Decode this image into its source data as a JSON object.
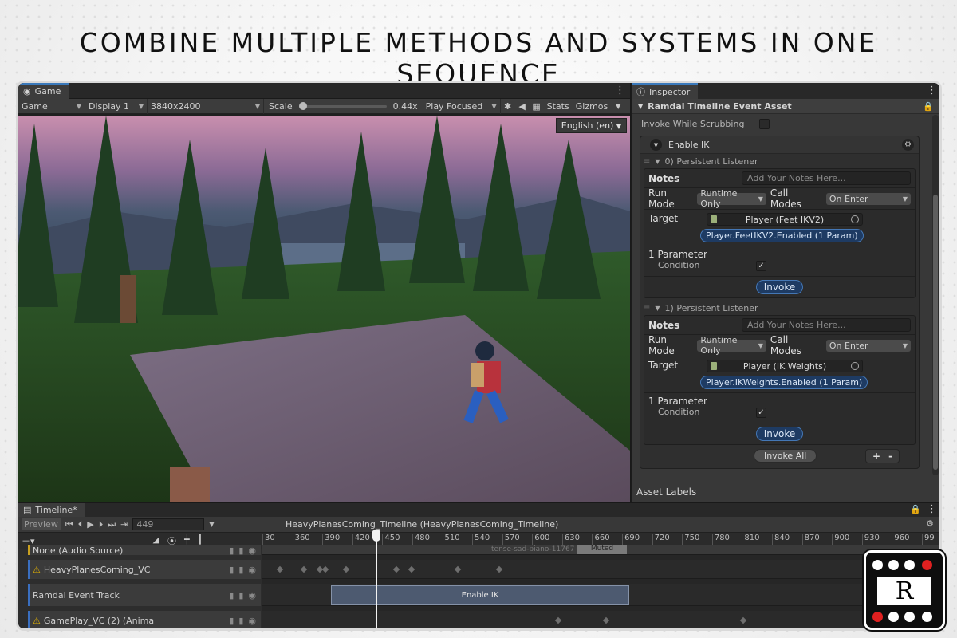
{
  "headline": "COMBINE MULTIPLE METHODS AND SYSTEMS IN ONE SEQUENCE",
  "game": {
    "tab_label": "Game",
    "mode": "Game",
    "display": "Display 1",
    "resolution": "3840x2400",
    "scale_label": "Scale",
    "scale_value": "0.44x",
    "play_focused": "Play Focused",
    "stats": "Stats",
    "gizmos": "Gizmos",
    "language": "English (en)"
  },
  "inspector": {
    "tab_label": "Inspector",
    "component_title": "Ramdal Timeline Event Asset",
    "invoke_while_scrubbing": "Invoke While Scrubbing",
    "invoke_while_scrubbing_checked": false,
    "event_name": "Enable IK",
    "listeners": [
      {
        "title": "0) Persistent Listener",
        "notes_label": "Notes",
        "notes_placeholder": "Add Your Notes Here...",
        "run_mode_label": "Run Mode",
        "run_mode": "Runtime Only",
        "call_modes_label": "Call Modes",
        "call_modes": "On Enter",
        "target_label": "Target",
        "target": "Player (Feet IKV2)",
        "method": "Player.FeetIKV2.Enabled (1 Param)",
        "param_count": "1 Parameter",
        "param_name": "Condition",
        "param_checked": true,
        "invoke": "Invoke"
      },
      {
        "title": "1) Persistent Listener",
        "notes_label": "Notes",
        "notes_placeholder": "Add Your Notes Here...",
        "run_mode_label": "Run Mode",
        "run_mode": "Runtime Only",
        "call_modes_label": "Call Modes",
        "call_modes": "On Enter",
        "target_label": "Target",
        "target": "Player (IK Weights)",
        "method": "Player.IKWeights.Enabled (1 Param)",
        "param_count": "1 Parameter",
        "param_name": "Condition",
        "param_checked": true,
        "invoke": "Invoke"
      }
    ],
    "invoke_all": "Invoke All",
    "plus": "+",
    "minus": "-",
    "asset_labels": "Asset Labels"
  },
  "timeline": {
    "tab_label": "Timeline*",
    "preview": "Preview",
    "frame": "449",
    "title": "HeavyPlanesComing_Timeline (HeavyPlanesComing_Timeline)",
    "ticks": [
      "30",
      "360",
      "390",
      "420",
      "450",
      "480",
      "510",
      "540",
      "570",
      "600",
      "630",
      "660",
      "690",
      "720",
      "750",
      "780",
      "810",
      "840",
      "870",
      "900",
      "930",
      "960",
      "99"
    ],
    "tracks": [
      {
        "name": "None (Audio Source)",
        "warn": false
      },
      {
        "name": "HeavyPlanesComing_VC",
        "warn": true
      },
      {
        "name": "Ramdal Event Track",
        "warn": false
      },
      {
        "name": "GamePlay_VC (2) (Anima",
        "warn": true
      }
    ],
    "audio_clip": "tense-sad-piano-11767",
    "muted_label": "Muted",
    "event_clip": "Enable IK"
  },
  "logo": {
    "letter": "R"
  }
}
